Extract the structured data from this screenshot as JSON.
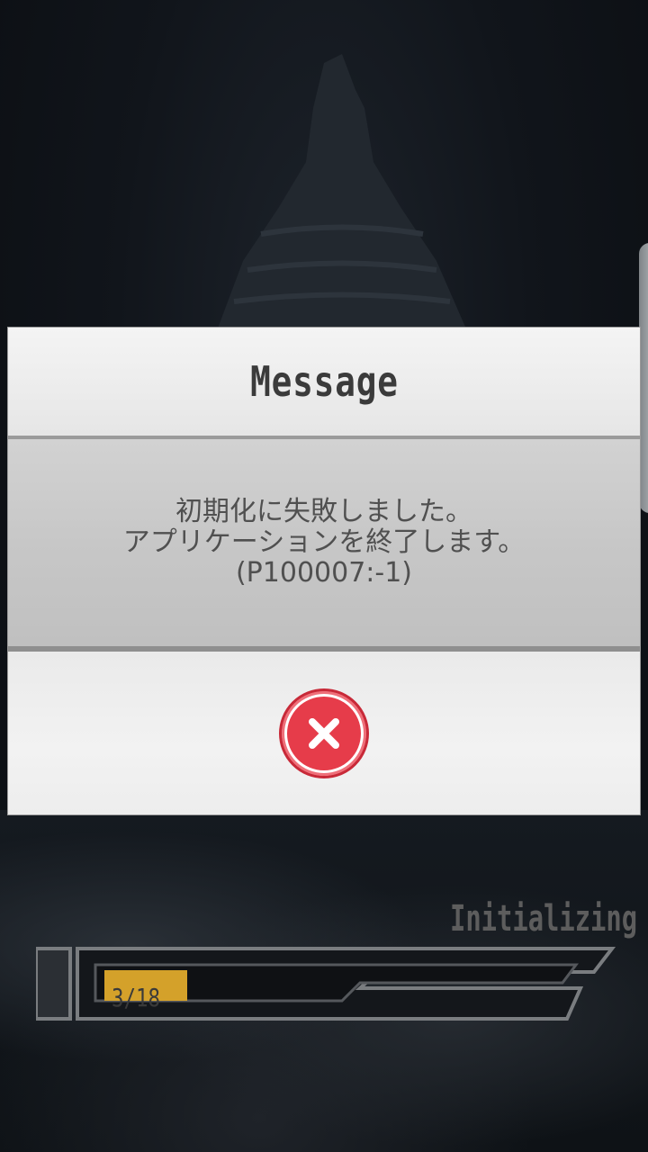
{
  "dialog": {
    "title": "Message",
    "message_lines": [
      "初期化に失敗しました。",
      "アプリケーションを終了します。",
      "(P100007:-1)"
    ],
    "close_icon": "close-icon"
  },
  "loading": {
    "status": "Initializing",
    "progress_label": "3/18",
    "progress_fraction": 0.167
  },
  "colors": {
    "close_button": "#e63c4a",
    "progress_fill": "#d4a12a"
  }
}
